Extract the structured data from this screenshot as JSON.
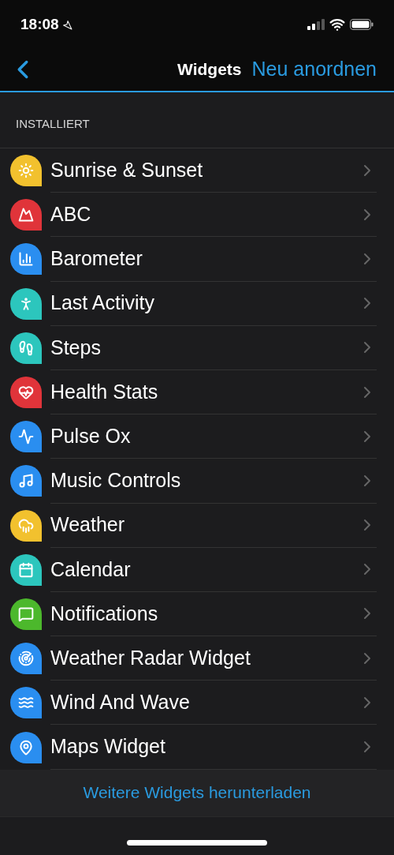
{
  "status_bar": {
    "time": "18:08"
  },
  "nav": {
    "title": "Widgets",
    "action": "Neu anordnen"
  },
  "section": "INSTALLIERT",
  "widgets": [
    {
      "name": "Sunrise & Sunset",
      "color": "#f2c12e"
    },
    {
      "name": "ABC",
      "color": "#e0343a"
    },
    {
      "name": "Barometer",
      "color": "#2a8ef0"
    },
    {
      "name": "Last Activity",
      "color": "#2cc6bd"
    },
    {
      "name": "Steps",
      "color": "#2cc6bd"
    },
    {
      "name": "Health Stats",
      "color": "#e0343a"
    },
    {
      "name": "Pulse Ox",
      "color": "#2a8ef0"
    },
    {
      "name": "Music Controls",
      "color": "#2a8ef0"
    },
    {
      "name": "Weather",
      "color": "#f2c12e"
    },
    {
      "name": "Calendar",
      "color": "#2cc6bd"
    },
    {
      "name": "Notifications",
      "color": "#4cb82c"
    },
    {
      "name": "Weather Radar Widget",
      "color": "#2a8ef0"
    },
    {
      "name": "Wind And Wave",
      "color": "#2a8ef0"
    },
    {
      "name": "Maps Widget",
      "color": "#2a8ef0"
    }
  ],
  "footer_link": "Weitere Widgets herunterladen"
}
